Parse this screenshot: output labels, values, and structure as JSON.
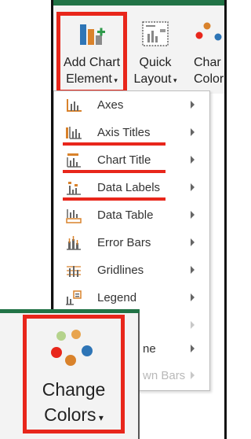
{
  "ribbon": {
    "add_chart_element": {
      "line1": "Add Chart",
      "line2": "Element"
    },
    "quick_layout": {
      "line1": "Quick",
      "line2": "Layout"
    },
    "change_colors_partial": {
      "line1": "Char",
      "line2": "Color"
    }
  },
  "menu": {
    "items": [
      {
        "label": "Axes",
        "icon": "axes-icon"
      },
      {
        "label": "Axis Titles",
        "icon": "axis-titles-icon"
      },
      {
        "label": "Chart Title",
        "icon": "chart-title-icon"
      },
      {
        "label": "Data Labels",
        "icon": "data-labels-icon"
      },
      {
        "label": "Data Table",
        "icon": "data-table-icon"
      },
      {
        "label": "Error Bars",
        "icon": "error-bars-icon"
      },
      {
        "label": "Gridlines",
        "icon": "gridlines-icon"
      },
      {
        "label": "Legend",
        "icon": "legend-icon"
      },
      {
        "label": "ne"
      },
      {
        "label": "wn Bars"
      }
    ]
  },
  "inset": {
    "change_colors": {
      "line1": "Change",
      "line2": "Colors"
    }
  },
  "colors": {
    "highlight_red": "#e8261b",
    "excel_green": "#217346",
    "icon_orange": "#d9822b",
    "icon_blue": "#2e75b6"
  }
}
